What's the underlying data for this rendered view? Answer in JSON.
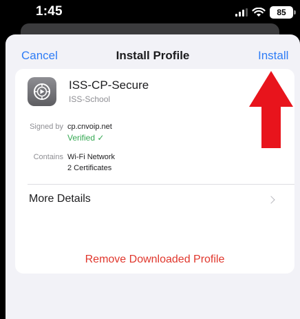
{
  "status_bar": {
    "time": "1:45",
    "battery": "85"
  },
  "nav": {
    "cancel_label": "Cancel",
    "title": "Install Profile",
    "install_label": "Install"
  },
  "profile": {
    "name": "ISS-CP-Secure",
    "organization": "ISS-School",
    "signed_by_label": "Signed by",
    "signed_by_value": "cp.cnvoip.net",
    "verified_label": "Verified ✓",
    "contains_label": "Contains",
    "contains_items": [
      "Wi-Fi Network",
      "2 Certificates"
    ],
    "more_details_label": "More Details"
  },
  "actions": {
    "remove_label": "Remove Downloaded Profile"
  },
  "colors": {
    "accent": "#2e7cf6",
    "destructive": "#e0362c",
    "verified": "#34a852",
    "annotation_arrow": "#e8141c"
  },
  "icons": {
    "profile": "gear-icon",
    "annotation": "red-up-arrow"
  }
}
